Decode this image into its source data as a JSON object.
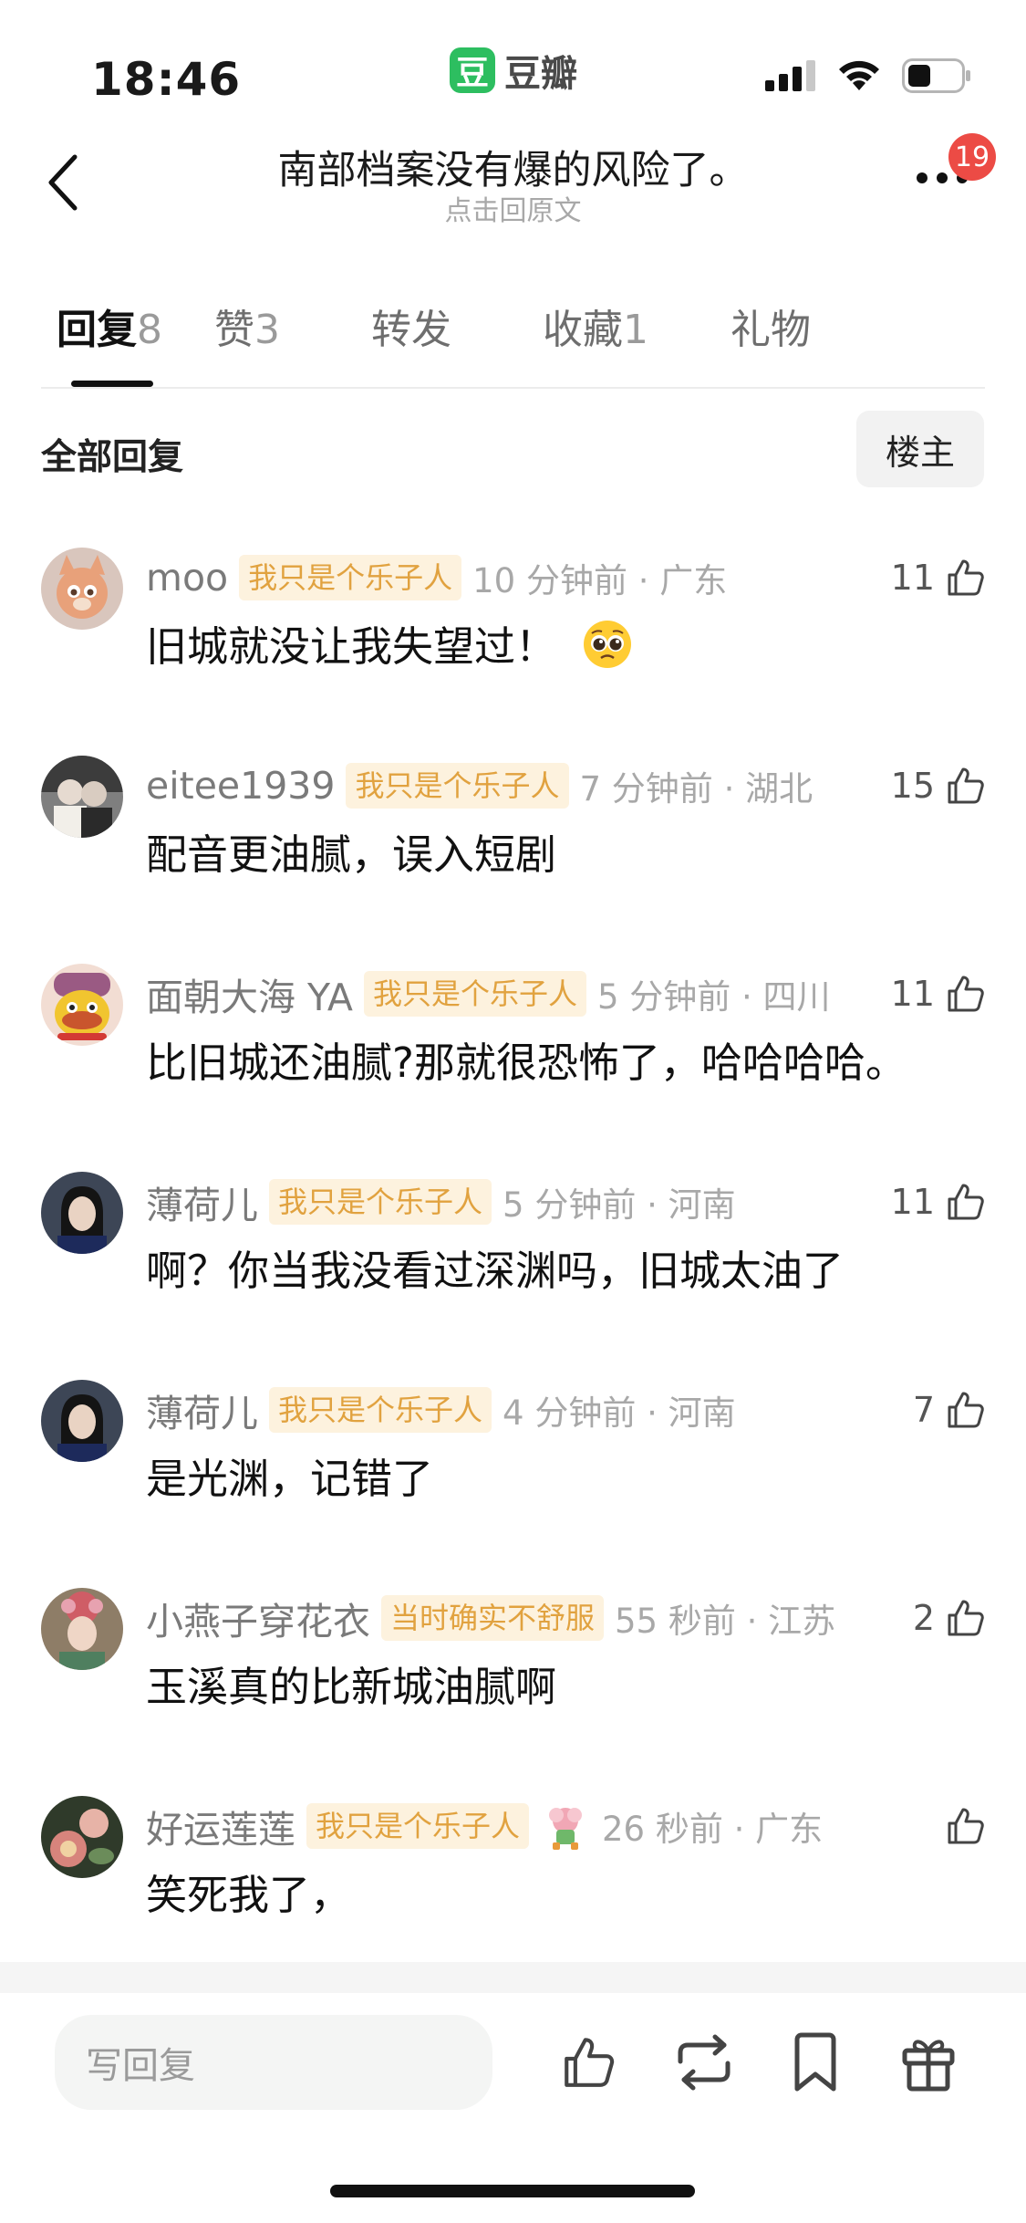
{
  "status_bar": {
    "time": "18:46",
    "app_logo_text": "豆",
    "app_name": "豆瓣"
  },
  "header": {
    "title": "南部档案没有爆的风险了。",
    "subtitle": "点击回原文",
    "notification_count": "19"
  },
  "tabs": [
    {
      "label": "回复",
      "count": "8",
      "active": true
    },
    {
      "label": "赞",
      "count": "3"
    },
    {
      "label": "转发",
      "count": ""
    },
    {
      "label": "收藏",
      "count": "1"
    },
    {
      "label": "礼物",
      "count": ""
    }
  ],
  "filter": {
    "label": "全部回复",
    "owner_button": "楼主"
  },
  "comments": [
    {
      "username": "moo",
      "tag": "我只是个乐子人",
      "time_location": "10 分钟前 · 广东",
      "likes": "11",
      "text": "旧城就没让我失望过！",
      "emoji": "pleading-face"
    },
    {
      "username": "eitee1939",
      "tag": "我只是个乐子人",
      "time_location": "7 分钟前 · 湖北",
      "likes": "15",
      "text": "配音更油腻，误入短剧"
    },
    {
      "username": "面朝大海 YA",
      "tag": "我只是个乐子人",
      "time_location": "5 分钟前 · 四川",
      "likes": "11",
      "text": "比旧城还油腻?那就很恐怖了，哈哈哈哈。"
    },
    {
      "username": "薄荷儿",
      "tag": "我只是个乐子人",
      "time_location": "5 分钟前 · 河南",
      "likes": "11",
      "text": "啊？你当我没看过深渊吗，旧城太油了"
    },
    {
      "username": "薄荷儿",
      "tag": "我只是个乐子人",
      "time_location": "4 分钟前 · 河南",
      "likes": "7",
      "text": "是光渊，记错了"
    },
    {
      "username": "小燕子穿花衣",
      "tag": "当时确实不舒服",
      "time_location": "55 秒前 · 江苏",
      "likes": "2",
      "text": "玉溪真的比新城油腻啊"
    },
    {
      "username": "好运莲莲",
      "tag": "我只是个乐子人",
      "time_location": "26 秒前 · 广东",
      "likes": "",
      "text": "笑死我了，"
    }
  ],
  "bottom_bar": {
    "reply_placeholder": "写回复"
  },
  "colors": {
    "accent_green": "#2dbe60",
    "tag_bg": "#fdf2de",
    "tag_text": "#e1a23f",
    "badge_red": "#ec4b45"
  }
}
